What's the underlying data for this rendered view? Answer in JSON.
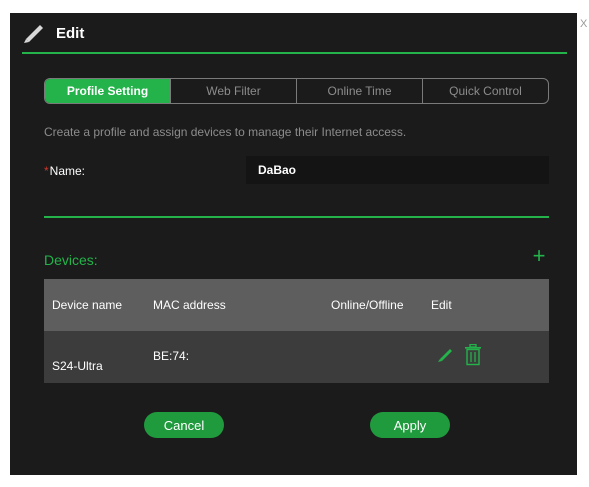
{
  "dialog": {
    "close_label": "X",
    "title": "Edit"
  },
  "tabs": [
    {
      "label": "Profile Setting",
      "active": true
    },
    {
      "label": "Web Filter",
      "active": false
    },
    {
      "label": "Online Time",
      "active": false
    },
    {
      "label": "Quick Control",
      "active": false
    }
  ],
  "description": "Create a profile and assign devices to manage their Internet access.",
  "name_field": {
    "required_marker": "*",
    "label": "Name:",
    "value": "DaBao"
  },
  "devices": {
    "label": "Devices:",
    "add_icon": "plus-icon",
    "columns": [
      "Device name",
      "MAC address",
      "Online/Offline",
      "Edit"
    ],
    "rows": [
      {
        "device_name": "S24-Ultra",
        "mac_address": "BE:74:",
        "status": ""
      }
    ]
  },
  "buttons": {
    "cancel": "Cancel",
    "apply": "Apply"
  },
  "colors": {
    "accent": "#23b34a",
    "background": "#1b1b1b",
    "table_header": "#5e5e5e",
    "table_row": "#3c3c3c"
  }
}
